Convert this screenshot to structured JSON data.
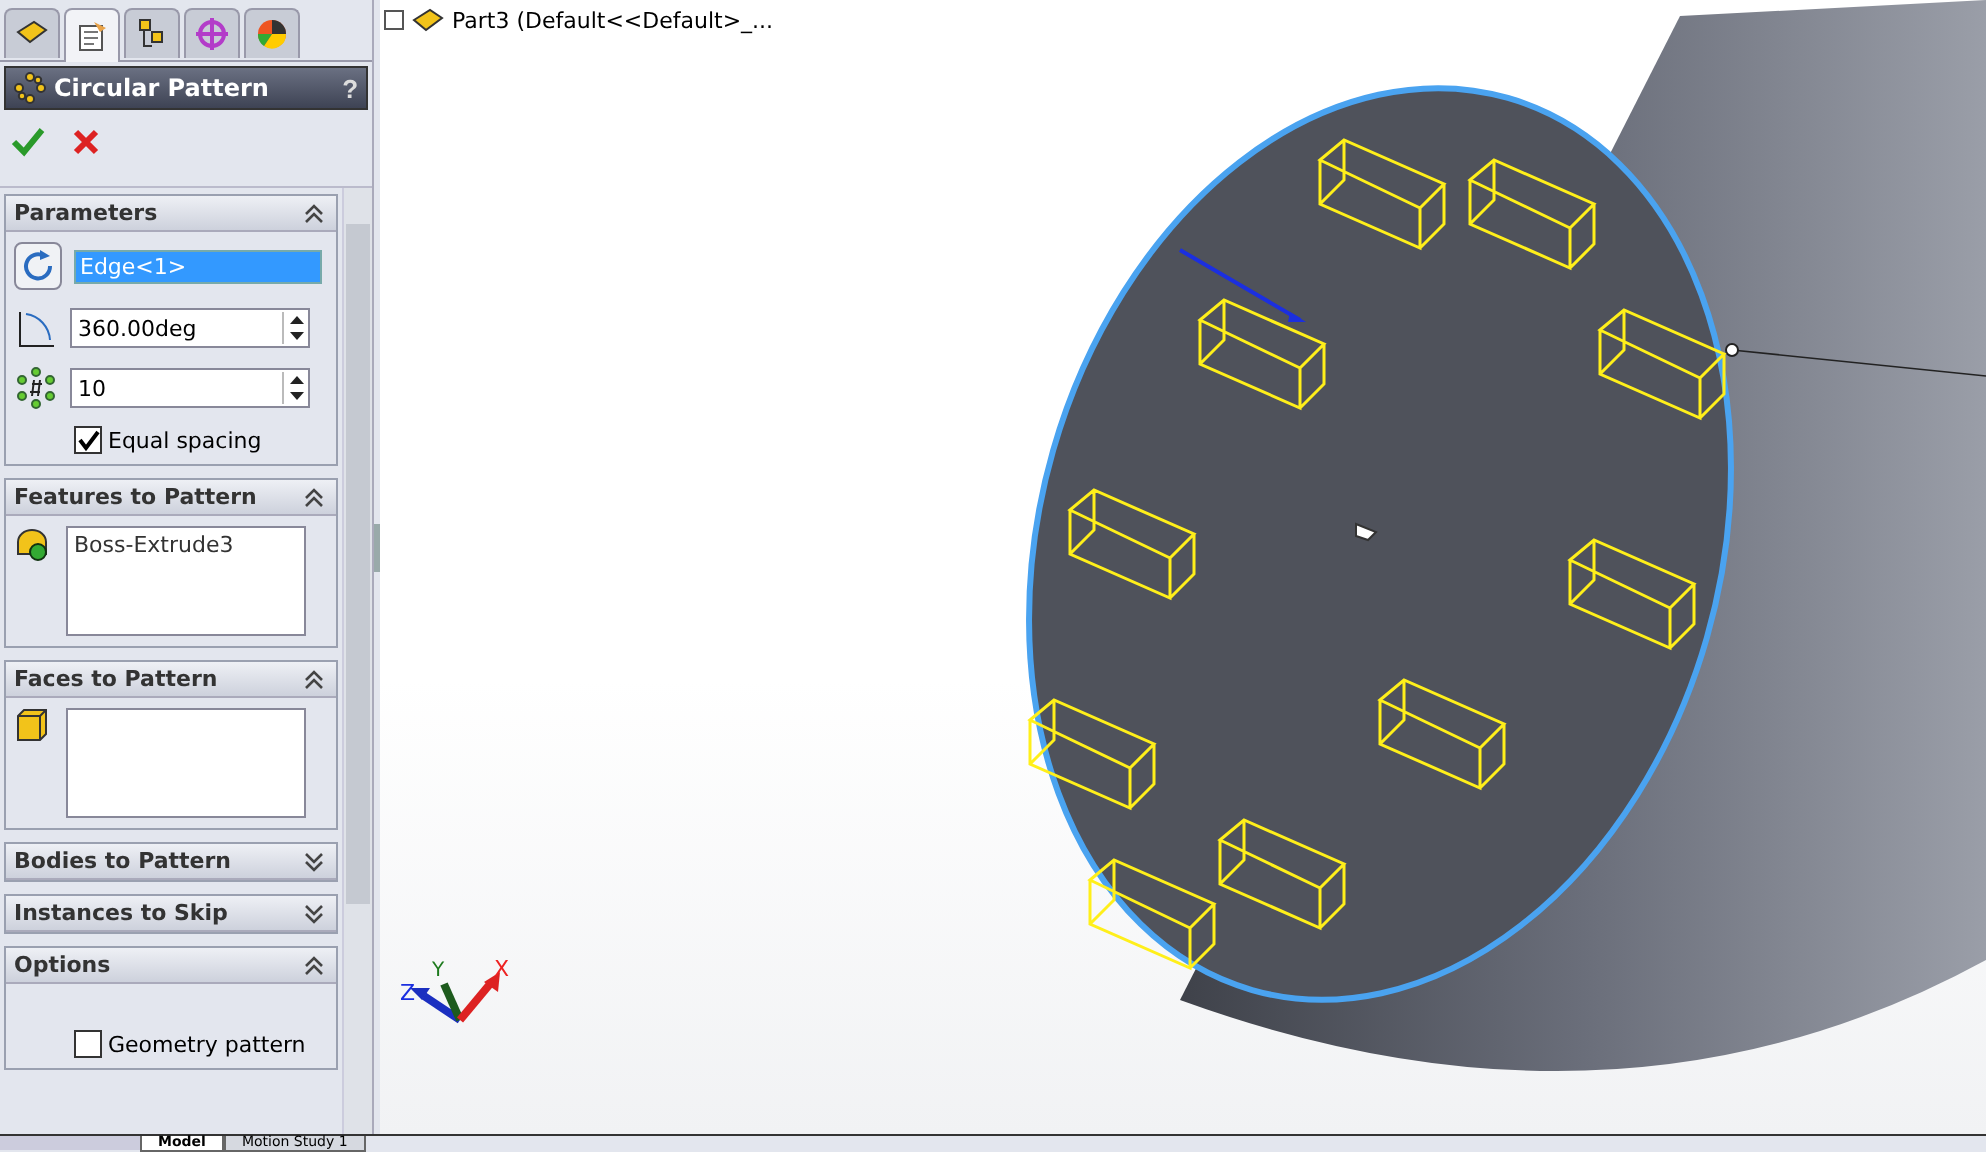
{
  "panel_tabs": [
    {
      "selected": false
    },
    {
      "selected": true
    },
    {
      "selected": false
    },
    {
      "selected": false
    },
    {
      "selected": false
    }
  ],
  "panel_title": "Circular Pattern",
  "help": "?",
  "sections": [
    {
      "kind": "parameters",
      "title": "Parameters",
      "expanded": true,
      "edge": "Edge<1>",
      "angle": "360.00deg",
      "count": "10",
      "equal_spacing": {
        "label": "Equal spacing",
        "checked": true
      }
    },
    {
      "kind": "features",
      "title": "Features to Pattern",
      "expanded": true,
      "items": [
        "Boss-Extrude3"
      ]
    },
    {
      "kind": "faces",
      "title": "Faces to Pattern",
      "expanded": true
    },
    {
      "title": "Bodies to Pattern",
      "expanded": false
    },
    {
      "title": "Instances to Skip",
      "expanded": false
    },
    {
      "kind": "options",
      "title": "Options",
      "expanded": true,
      "geometry_pattern": {
        "label": "Geometry pattern",
        "checked": false
      }
    }
  ],
  "tree": {
    "label": "Part3  (Default<<Default>_..."
  },
  "bottom_tabs": [
    {
      "label": "Model",
      "selected": true
    },
    {
      "label": "Motion Study 1",
      "selected": false
    }
  ],
  "triad": {
    "x": "X",
    "y": "Y",
    "z": "Z"
  }
}
